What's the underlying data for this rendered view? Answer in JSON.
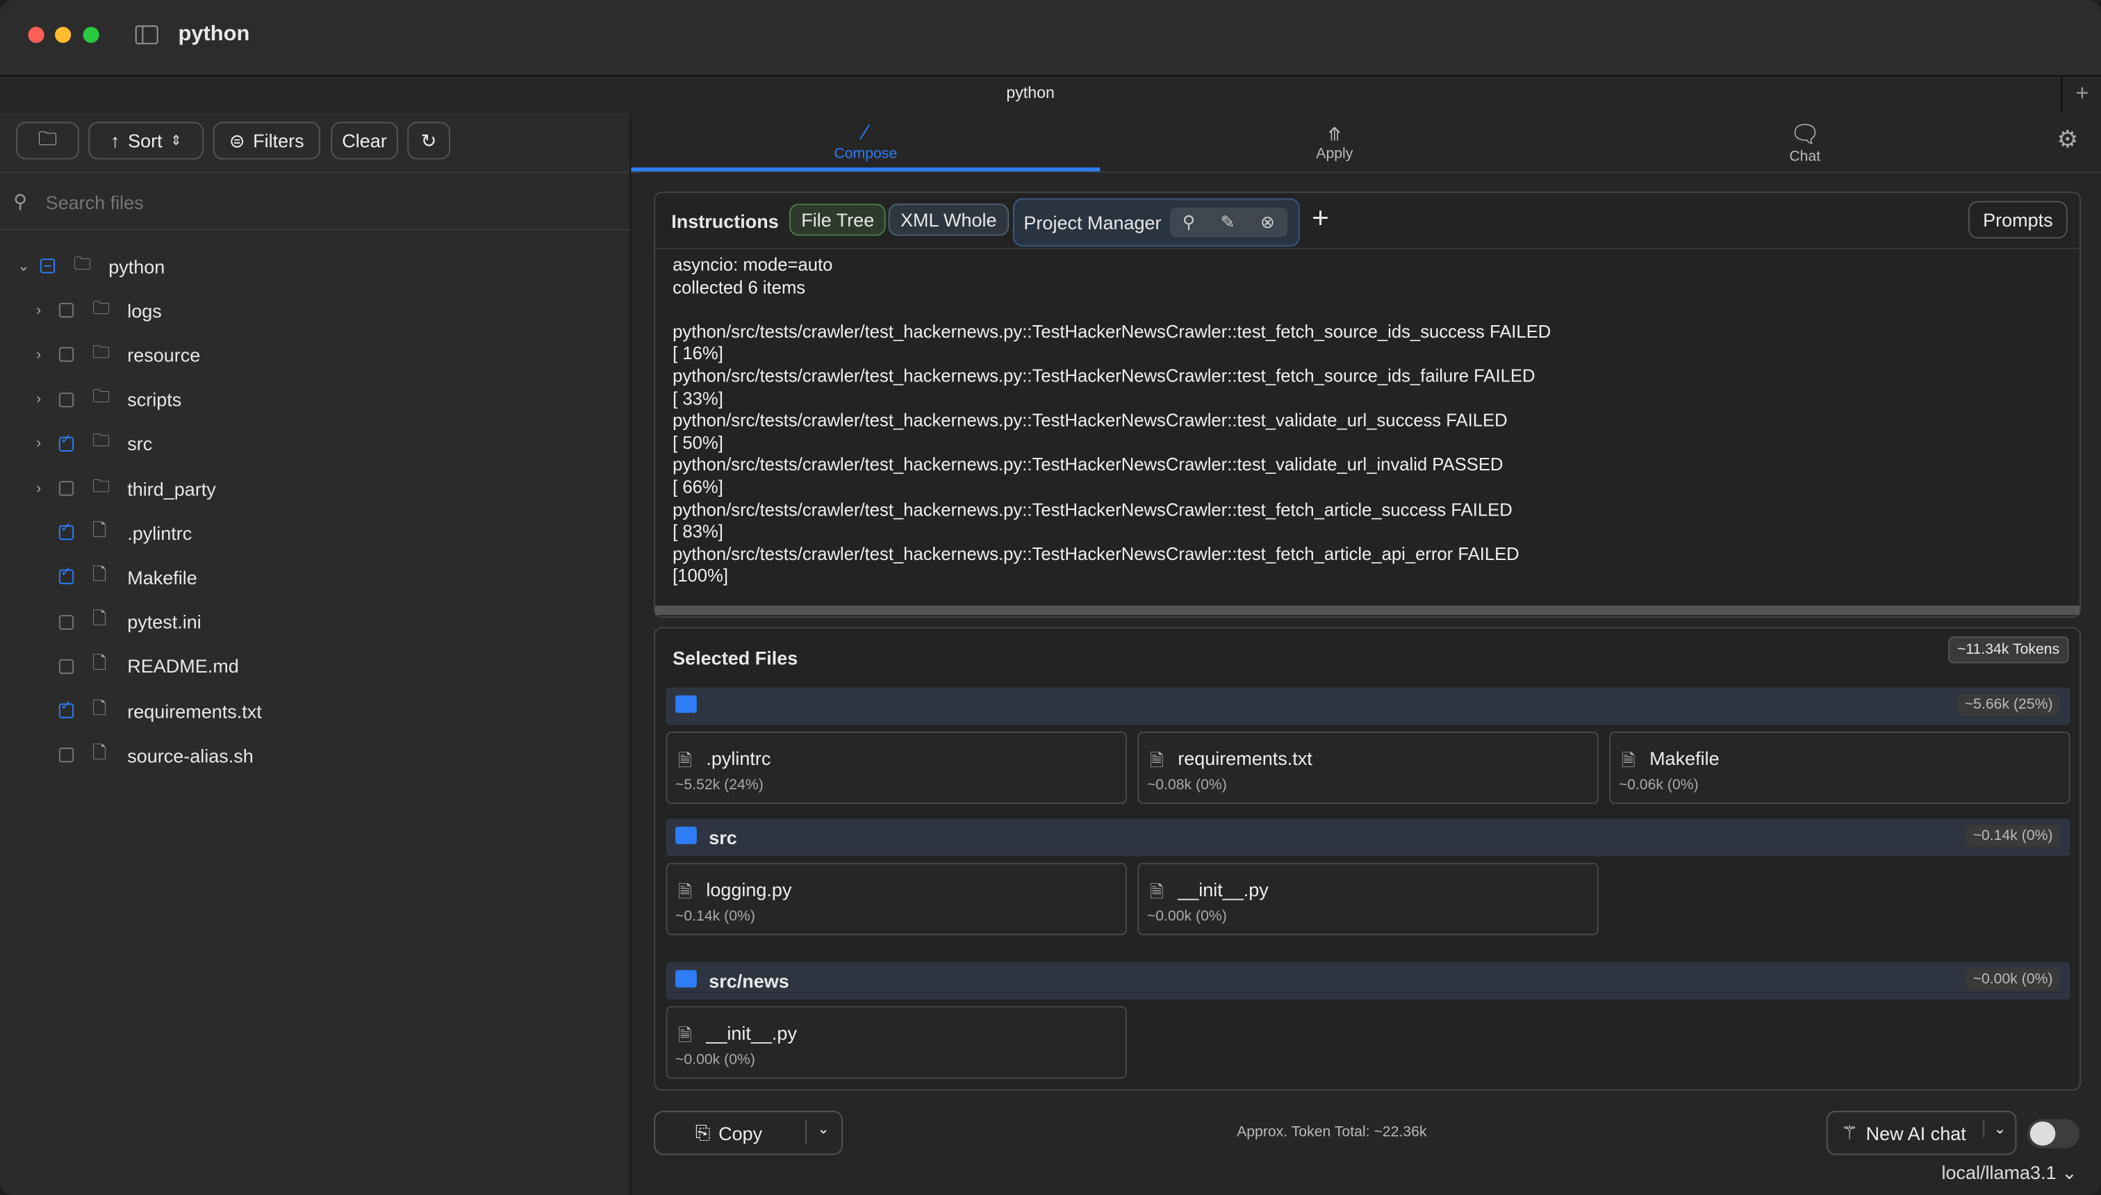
{
  "window": {
    "title": "python",
    "tab": "python"
  },
  "toolbar": {
    "sort": "Sort",
    "filters": "Filters",
    "clear": "Clear"
  },
  "search": {
    "placeholder": "Search files"
  },
  "tree": [
    {
      "name": "python",
      "type": "folder",
      "state": "mixed",
      "expanded": true,
      "depth": 0
    },
    {
      "name": "logs",
      "type": "folder",
      "state": "off",
      "depth": 1
    },
    {
      "name": "resource",
      "type": "folder",
      "state": "off",
      "depth": 1
    },
    {
      "name": "scripts",
      "type": "folder",
      "state": "off",
      "depth": 1
    },
    {
      "name": "src",
      "type": "folder",
      "state": "on",
      "depth": 1
    },
    {
      "name": "third_party",
      "type": "folder",
      "state": "off",
      "depth": 1
    },
    {
      "name": ".pylintrc",
      "type": "file",
      "state": "on",
      "depth": 1
    },
    {
      "name": "Makefile",
      "type": "file",
      "state": "on",
      "depth": 1
    },
    {
      "name": "pytest.ini",
      "type": "file",
      "state": "off",
      "depth": 1
    },
    {
      "name": "README.md",
      "type": "file",
      "state": "off",
      "depth": 1
    },
    {
      "name": "requirements.txt",
      "type": "file",
      "state": "on",
      "depth": 1
    },
    {
      "name": "source-alias.sh",
      "type": "file",
      "state": "off",
      "depth": 1
    }
  ],
  "modes": [
    {
      "label": "Compose",
      "active": true
    },
    {
      "label": "Apply"
    },
    {
      "label": "Chat"
    }
  ],
  "instructions": {
    "label": "Instructions",
    "chips": [
      "File Tree",
      "XML Whole",
      "Project Manager"
    ],
    "prompts": "Prompts"
  },
  "output": [
    "asyncio: mode=auto",
    "collected 6 items",
    "",
    "python/src/tests/crawler/test_hackernews.py::TestHackerNewsCrawler::test_fetch_source_ids_success FAILED",
    "[ 16%]",
    "python/src/tests/crawler/test_hackernews.py::TestHackerNewsCrawler::test_fetch_source_ids_failure FAILED",
    "[ 33%]",
    "python/src/tests/crawler/test_hackernews.py::TestHackerNewsCrawler::test_validate_url_success FAILED",
    "[ 50%]",
    "python/src/tests/crawler/test_hackernews.py::TestHackerNewsCrawler::test_validate_url_invalid PASSED",
    "[ 66%]",
    "python/src/tests/crawler/test_hackernews.py::TestHackerNewsCrawler::test_fetch_article_success FAILED",
    "[ 83%]",
    "python/src/tests/crawler/test_hackernews.py::TestHackerNewsCrawler::test_fetch_article_api_error FAILED",
    "[100%]"
  ],
  "selected": {
    "title": "Selected Files",
    "tokens": "~11.34k Tokens",
    "groups": [
      {
        "name": "",
        "tokens": "~5.66k (25%)",
        "files": [
          {
            "name": ".pylintrc",
            "tokens": "~5.52k (24%)"
          },
          {
            "name": "requirements.txt",
            "tokens": "~0.08k (0%)"
          },
          {
            "name": "Makefile",
            "tokens": "~0.06k (0%)"
          }
        ]
      },
      {
        "name": "src",
        "tokens": "~0.14k (0%)",
        "files": [
          {
            "name": "logging.py",
            "tokens": "~0.14k (0%)"
          },
          {
            "name": "__init__.py",
            "tokens": "~0.00k (0%)"
          }
        ]
      },
      {
        "name": "src/news",
        "tokens": "~0.00k (0%)",
        "files": [
          {
            "name": "__init__.py",
            "tokens": "~0.00k (0%)"
          }
        ]
      }
    ]
  },
  "footer": {
    "copy": "Copy",
    "total": "Approx. Token Total: ~22.36k",
    "new_chat": "New AI chat",
    "model": "local/llama3.1"
  },
  "colors": {
    "accent": "#2e7cf6"
  }
}
